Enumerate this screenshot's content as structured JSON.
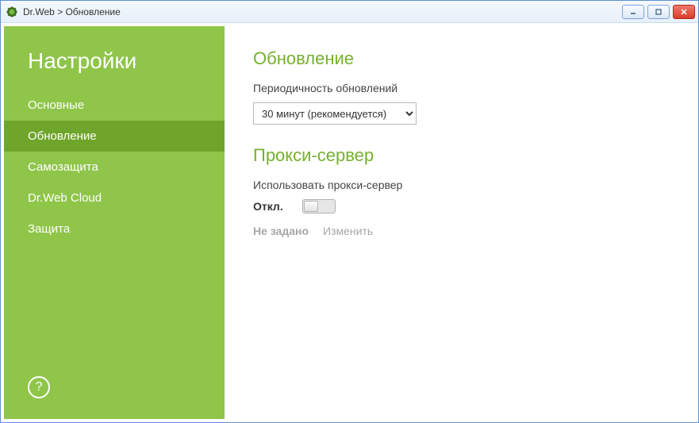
{
  "window": {
    "title": "Dr.Web > Обновление"
  },
  "sidebar": {
    "title": "Настройки",
    "items": [
      {
        "label": "Основные",
        "active": false
      },
      {
        "label": "Обновление",
        "active": true
      },
      {
        "label": "Самозащита",
        "active": false
      },
      {
        "label": "Dr.Web Cloud",
        "active": false
      },
      {
        "label": "Защита",
        "active": false
      }
    ],
    "help": "?"
  },
  "main": {
    "update": {
      "header": "Обновление",
      "frequency_label": "Периодичность обновлений",
      "frequency_value": "30 минут (рекомендуется)"
    },
    "proxy": {
      "header": "Прокси-сервер",
      "use_label": "Использовать прокси-сервер",
      "toggle_state": "Откл.",
      "status_value": "Не задано",
      "change_link": "Изменить"
    }
  }
}
